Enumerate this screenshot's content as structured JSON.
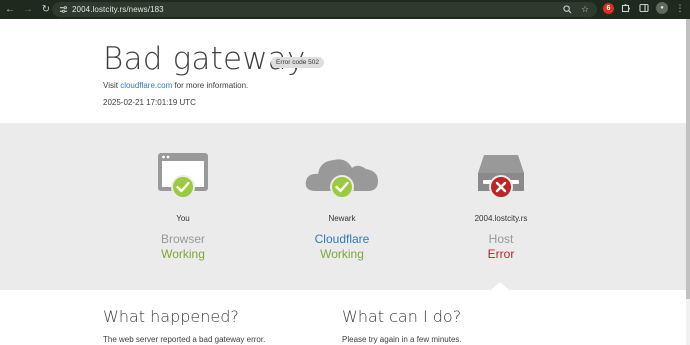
{
  "browser": {
    "url": "2004.lostcity.rs/news/183",
    "extension_badge": "6"
  },
  "page": {
    "title": "Bad gateway",
    "error_code": "Error code 502",
    "visit_prefix": "Visit ",
    "visit_link": "cloudflare.com",
    "visit_suffix": " for more information.",
    "timestamp": "2025-02-21 17:01:19 UTC"
  },
  "status": [
    {
      "location": "You",
      "kind": "Browser",
      "state": "Working",
      "state_type": "working",
      "icon": "browser-icon"
    },
    {
      "location": "Newark",
      "kind": "Cloudflare",
      "state": "Working",
      "state_type": "working",
      "icon": "cloud-icon"
    },
    {
      "location": "2004.lostcity.rs",
      "kind": "Host",
      "state": "Error",
      "state_type": "error",
      "icon": "server-icon"
    }
  ],
  "sections": {
    "what_happened": {
      "heading": "What happened?",
      "text": "The web server reported a bad gateway error."
    },
    "what_can_i_do": {
      "heading": "What can I do?",
      "text": "Please try again in a few minutes."
    }
  },
  "colors": {
    "working": "#7ea73b",
    "error": "#bd2426",
    "link": "#2f7bbf",
    "band": "#ebebeb"
  }
}
